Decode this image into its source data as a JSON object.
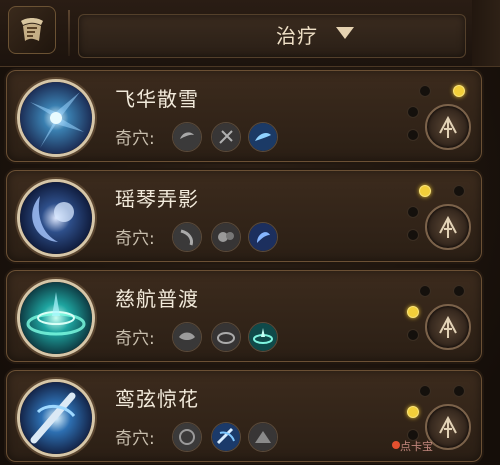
{
  "header": {
    "filter_label": "治疗"
  },
  "skills": [
    {
      "name": "飞华散雪",
      "qixue_label": "奇穴:",
      "selected_dot": "top-right",
      "colors": {
        "core": "#3a7fb0",
        "glow": "#9ad6ff",
        "accent": "#1c2d55"
      }
    },
    {
      "name": "瑶琴弄影",
      "qixue_label": "奇穴:",
      "selected_dot": "top-left",
      "colors": {
        "core": "#2e4f8a",
        "glow": "#a9c8ff",
        "accent": "#101c3d"
      }
    },
    {
      "name": "慈航普渡",
      "qixue_label": "奇穴:",
      "selected_dot": "mid-left",
      "colors": {
        "core": "#1ea5a0",
        "glow": "#7fffe3",
        "accent": "#0e3b43"
      }
    },
    {
      "name": "鸾弦惊花",
      "qixue_label": "奇穴:",
      "selected_dot": "mid-left",
      "colors": {
        "core": "#2d6fb1",
        "glow": "#9fd9ff",
        "accent": "#142448"
      }
    }
  ],
  "watermark": "点卡宝"
}
